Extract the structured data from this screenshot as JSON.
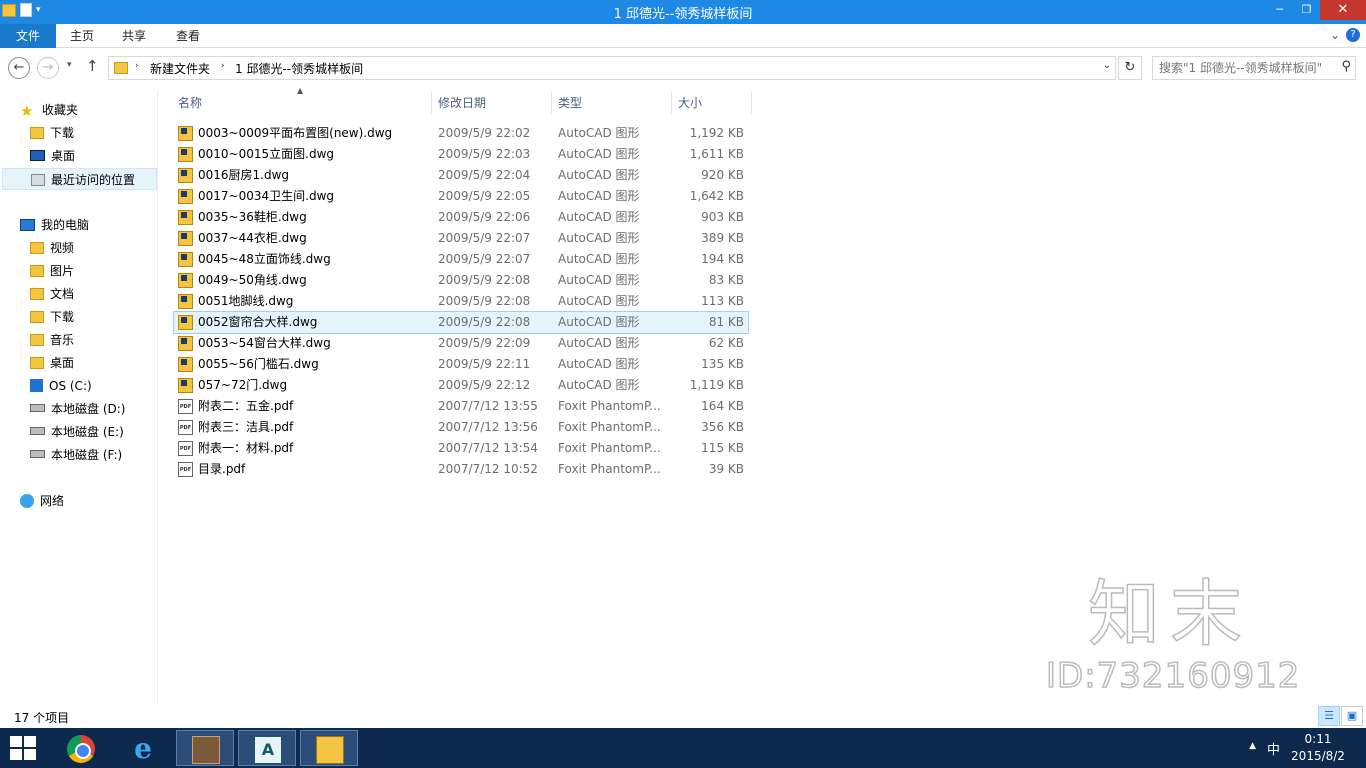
{
  "window": {
    "title": "1 邱德光--领秀城样板间",
    "minimize": "─",
    "maximize": "❐",
    "close": "✕"
  },
  "ribbon": {
    "tabs": [
      "文件",
      "主页",
      "共享",
      "查看"
    ],
    "expand": "⌄",
    "help": "?"
  },
  "address": {
    "back": "←",
    "forward": "→",
    "recent": "▾",
    "up": "↑",
    "breadcrumbs": [
      "新建文件夹",
      "1 邱德光--领秀城样板间"
    ],
    "dropdown": "⌄",
    "refresh": "↻",
    "search_placeholder": "搜索\"1 邱德光--领秀城样板间\"",
    "search_icon": "⚲"
  },
  "nav": {
    "favorites": {
      "label": "收藏夹",
      "items": [
        "下载",
        "桌面",
        "最近访问的位置"
      ]
    },
    "this_pc": {
      "label": "我的电脑",
      "items": [
        "视频",
        "图片",
        "文档",
        "下载",
        "音乐",
        "桌面",
        "OS (C:)",
        "本地磁盘 (D:)",
        "本地磁盘 (E:)",
        "本地磁盘 (F:)"
      ]
    },
    "network": {
      "label": "网络"
    }
  },
  "columns": [
    "名称",
    "修改日期",
    "类型",
    "大小"
  ],
  "files": [
    {
      "name": "0003~0009平面布置图(new).dwg",
      "date": "2009/5/9 22:02",
      "type": "AutoCAD 图形",
      "size": "1,192 KB",
      "kind": "dwg"
    },
    {
      "name": "0010~0015立面图.dwg",
      "date": "2009/5/9 22:03",
      "type": "AutoCAD 图形",
      "size": "1,611 KB",
      "kind": "dwg"
    },
    {
      "name": "0016厨房1.dwg",
      "date": "2009/5/9 22:04",
      "type": "AutoCAD 图形",
      "size": "920 KB",
      "kind": "dwg"
    },
    {
      "name": "0017~0034卫生间.dwg",
      "date": "2009/5/9 22:05",
      "type": "AutoCAD 图形",
      "size": "1,642 KB",
      "kind": "dwg"
    },
    {
      "name": "0035~36鞋柜.dwg",
      "date": "2009/5/9 22:06",
      "type": "AutoCAD 图形",
      "size": "903 KB",
      "kind": "dwg"
    },
    {
      "name": "0037~44衣柜.dwg",
      "date": "2009/5/9 22:07",
      "type": "AutoCAD 图形",
      "size": "389 KB",
      "kind": "dwg"
    },
    {
      "name": "0045~48立面饰线.dwg",
      "date": "2009/5/9 22:07",
      "type": "AutoCAD 图形",
      "size": "194 KB",
      "kind": "dwg"
    },
    {
      "name": "0049~50角线.dwg",
      "date": "2009/5/9 22:08",
      "type": "AutoCAD 图形",
      "size": "83 KB",
      "kind": "dwg"
    },
    {
      "name": "0051地脚线.dwg",
      "date": "2009/5/9 22:08",
      "type": "AutoCAD 图形",
      "size": "113 KB",
      "kind": "dwg"
    },
    {
      "name": "0052窗帘合大样.dwg",
      "date": "2009/5/9 22:08",
      "type": "AutoCAD 图形",
      "size": "81 KB",
      "kind": "dwg",
      "selected": true
    },
    {
      "name": "0053~54窗台大样.dwg",
      "date": "2009/5/9 22:09",
      "type": "AutoCAD 图形",
      "size": "62 KB",
      "kind": "dwg"
    },
    {
      "name": "0055~56门槛石.dwg",
      "date": "2009/5/9 22:11",
      "type": "AutoCAD 图形",
      "size": "135 KB",
      "kind": "dwg"
    },
    {
      "name": "057~72门.dwg",
      "date": "2009/5/9 22:12",
      "type": "AutoCAD 图形",
      "size": "1,119 KB",
      "kind": "dwg"
    },
    {
      "name": "附表二：五金.pdf",
      "date": "2007/7/12 13:55",
      "type": "Foxit PhantomP...",
      "size": "164 KB",
      "kind": "pdf"
    },
    {
      "name": "附表三：洁具.pdf",
      "date": "2007/7/12 13:56",
      "type": "Foxit PhantomP...",
      "size": "356 KB",
      "kind": "pdf"
    },
    {
      "name": "附表一：材料.pdf",
      "date": "2007/7/12 13:54",
      "type": "Foxit PhantomP...",
      "size": "115 KB",
      "kind": "pdf"
    },
    {
      "name": "目录.pdf",
      "date": "2007/7/12 10:52",
      "type": "Foxit PhantomP...",
      "size": "39 KB",
      "kind": "pdf"
    }
  ],
  "status": {
    "count": "17 个项目"
  },
  "watermark": {
    "big": "知末",
    "id": "ID:732160912"
  },
  "taskbar": {
    "tray_up": "▲",
    "ime": "中",
    "time": "0:11",
    "date": "2015/8/2",
    "ie_glyph": "e",
    "acad_glyph": "A"
  },
  "colors": {
    "titlebar": "#1e88e5",
    "file_tab": "#1979ca",
    "close": "#c7372f",
    "selection": "#e5f3fb",
    "taskbar": "#0d2a4e"
  }
}
